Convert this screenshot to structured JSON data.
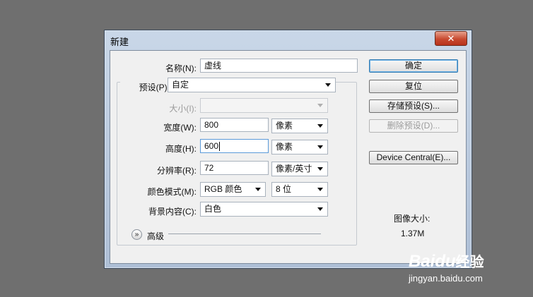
{
  "dialog": {
    "title": "新建",
    "close_glyph": "✕"
  },
  "form": {
    "name_label": "名称(N):",
    "name_value": "虚线",
    "preset_label": "预设(P):",
    "preset_value": "自定",
    "size_label": "大小(I):",
    "size_value": "",
    "width_label": "宽度(W):",
    "width_value": "800",
    "width_unit": "像素",
    "height_label": "高度(H):",
    "height_value": "600",
    "height_unit": "像素",
    "resolution_label": "分辨率(R):",
    "resolution_value": "72",
    "resolution_unit": "像素/英寸",
    "color_mode_label": "颜色模式(M):",
    "color_mode_value": "RGB 颜色",
    "bit_depth_value": "8 位",
    "background_label": "背景内容(C):",
    "background_value": "白色",
    "advanced_label": "高级"
  },
  "buttons": {
    "ok": "确定",
    "reset": "复位",
    "save_preset": "存储预设(S)...",
    "delete_preset": "删除预设(D)...",
    "device_central": "Device Central(E)..."
  },
  "image_size": {
    "label": "图像大小:",
    "value": "1.37M"
  },
  "watermark": {
    "brand": "Baidu",
    "brand_suffix": "经验",
    "url": "jingyan.baidu.com"
  },
  "colors": {
    "background": "#6f6f6f",
    "close_button": "#c84a30",
    "default_button_border": "#3c7fb1"
  }
}
